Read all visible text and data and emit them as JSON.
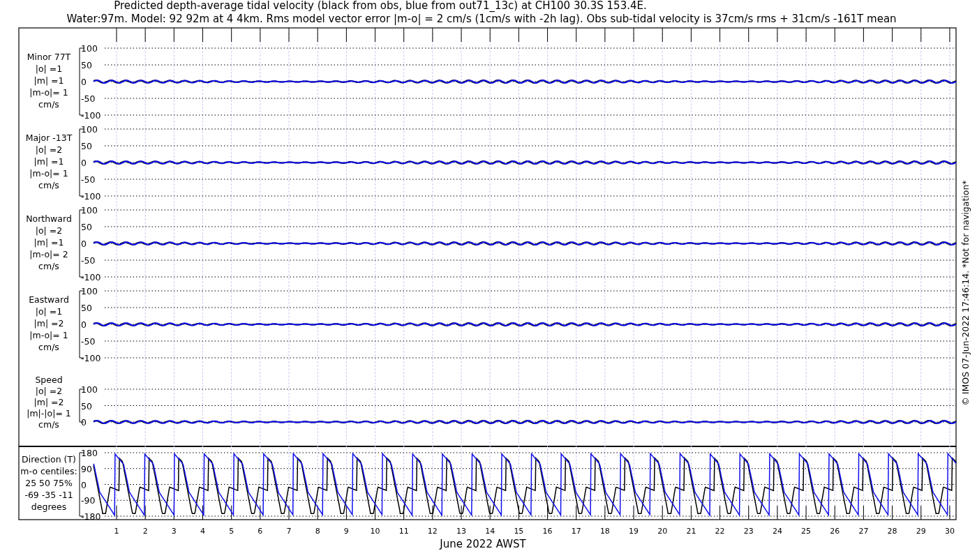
{
  "title": "Predicted depth-average tidal velocity (black from obs, blue from out71_13c) at CH100 30.3S 153.4E.",
  "subtitle": "Water:97m. Model: 92 92m at 4 4km. Rms model vector error |m-o| = 2 cm/s (1cm/s with -2h lag). Obs sub-tidal velocity is 37cm/s rms + 31cm/s -161T mean",
  "panels": [
    {
      "kind": "velocity",
      "label_lines": [
        "Minor 77T",
        "|o| =1",
        "|m| =1",
        "|m-o|= 1",
        "cm/s"
      ],
      "yticks": [
        "100",
        "50",
        "0",
        "-50",
        "-100"
      ]
    },
    {
      "kind": "velocity",
      "label_lines": [
        "Major -13T",
        "|o| =2",
        "|m| =1",
        "|m-o|= 1",
        "cm/s"
      ],
      "yticks": [
        "100",
        "50",
        "0",
        "-50",
        "-100"
      ]
    },
    {
      "kind": "velocity",
      "label_lines": [
        "Northward",
        "|o| =2",
        "|m| =1",
        "|m-o|= 2",
        "cm/s"
      ],
      "yticks": [
        "100",
        "50",
        "0",
        "-50",
        "-100"
      ]
    },
    {
      "kind": "velocity",
      "label_lines": [
        "Eastward",
        "|o| =1",
        "|m| =2",
        "|m-o|= 1",
        "cm/s"
      ],
      "yticks": [
        "100",
        "50",
        "0",
        "-50",
        "-100"
      ]
    },
    {
      "kind": "speed",
      "label_lines": [
        "Speed",
        "|o| =2",
        "|m| =2",
        "|m|-|o|= 1",
        "cm/s"
      ],
      "yticks": [
        "100",
        "50",
        "0"
      ]
    },
    {
      "kind": "direction",
      "label_lines": [
        "Direction (T)",
        "m-o centiles:",
        "25  50  75%",
        "-69 -35 -11",
        "degrees"
      ],
      "yticks": [
        "180",
        "90",
        "0",
        "-90",
        "-180"
      ]
    }
  ],
  "xticks": [
    "1",
    "2",
    "3",
    "4",
    "5",
    "6",
    "7",
    "8",
    "9",
    "10",
    "11",
    "12",
    "13",
    "14",
    "15",
    "16",
    "17",
    "18",
    "19",
    "20",
    "21",
    "22",
    "23",
    "24",
    "25",
    "26",
    "27",
    "28",
    "29",
    "30"
  ],
  "xlabel": "June 2022 AWST",
  "footer": "© IMOS 07-Jun-2022 17:46:14. *Not for navigation*"
}
